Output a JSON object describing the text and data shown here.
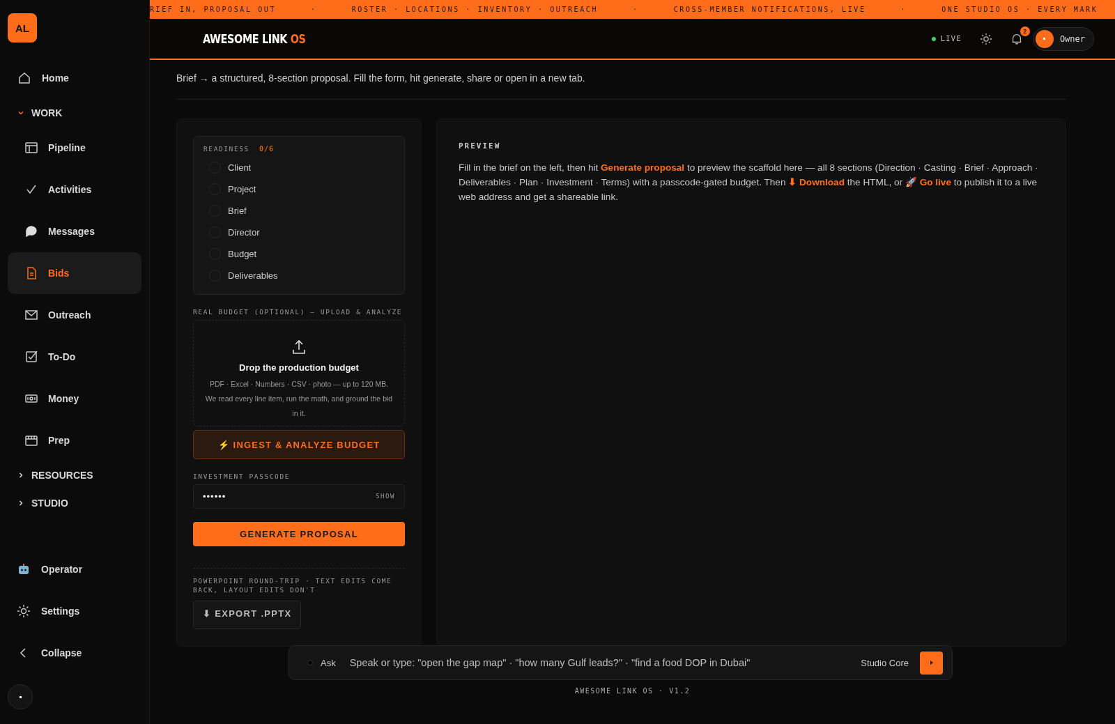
{
  "sidebar": {
    "logo": "AL",
    "items": [
      {
        "kind": "link",
        "label": "Home",
        "selected": false
      },
      {
        "kind": "section",
        "label": "WORK",
        "expanded": true,
        "children": [
          {
            "label": "Pipeline",
            "selected": false
          },
          {
            "label": "Activities",
            "selected": false
          },
          {
            "label": "Messages",
            "selected": false
          },
          {
            "label": "Bids",
            "selected": true
          },
          {
            "label": "Outreach",
            "selected": false
          },
          {
            "label": "To-Do",
            "selected": false
          },
          {
            "label": "Money",
            "selected": false
          },
          {
            "label": "Prep",
            "selected": false
          }
        ]
      },
      {
        "kind": "section",
        "label": "RESOURCES",
        "expanded": false
      },
      {
        "kind": "section",
        "label": "STUDIO",
        "expanded": false
      }
    ],
    "footer_items": [
      {
        "label": "Operator"
      },
      {
        "label": "Settings"
      },
      {
        "label": "Collapse"
      }
    ]
  },
  "ticker": {
    "separator": "·",
    "items": [
      "RIEF IN, PROPOSAL OUT",
      "ROSTER · LOCATIONS · INVENTORY · OUTREACH",
      "CROSS-MEMBER NOTIFICATIONS, LIVE",
      "ONE STUDIO OS · EVERY MARK"
    ]
  },
  "header": {
    "brand": "AWESOME LINK",
    "brand_suffix": "OS",
    "status": "LIVE",
    "notifications": "2",
    "user": "Owner"
  },
  "page": {
    "subtitle": "Brief → a structured, 8-section proposal. Fill the form, hit generate, share or open in a new tab."
  },
  "form": {
    "readiness": {
      "title": "READINESS",
      "count": "0/6",
      "items": [
        {
          "label": "Client",
          "checked": false
        },
        {
          "label": "Project",
          "checked": false
        },
        {
          "label": "Brief",
          "checked": false
        },
        {
          "label": "Director",
          "checked": false
        },
        {
          "label": "Budget",
          "checked": false
        },
        {
          "label": "Deliverables",
          "checked": false
        }
      ]
    },
    "budget_label": "REAL BUDGET (OPTIONAL) — UPLOAD & ANALYZE",
    "dropzone": {
      "title": "Drop the production budget",
      "text": "PDF · Excel · Numbers · CSV · photo — up to 120 MB. We read every line item, run the math, and ground the bid in it."
    },
    "ingest_button": "⚡ INGEST & ANALYZE BUDGET",
    "passcode": {
      "label": "INVESTMENT PASSCODE",
      "value": "••••••",
      "toggle": "SHOW"
    },
    "generate_button": "GENERATE PROPOSAL",
    "pptx_note": "POWERPOINT ROUND-TRIP · TEXT EDITS COME BACK, LAYOUT EDITS DON'T",
    "export_button": "⬇ EXPORT .PPTX"
  },
  "preview": {
    "title": "PREVIEW",
    "text": "Fill in the brief on the left, then hit **Generate proposal** to preview the scaffold here — all 8 sections (Direction · Casting · Brief · Approach · Deliverables · Plan · Investment · Terms) with a passcode-gated budget. Then **⬇ Download** the HTML, or 🚀 **Go live** to publish it to a live web address and get a shareable link."
  },
  "ask_bar": {
    "label": "Ask",
    "placeholder": "Speak or type: \"open the gap map\" · \"how many Gulf leads?\" · \"find a food DOP in Dubai\"",
    "model": "Studio Core"
  },
  "footer": "AWESOME LINK OS · V1.2"
}
